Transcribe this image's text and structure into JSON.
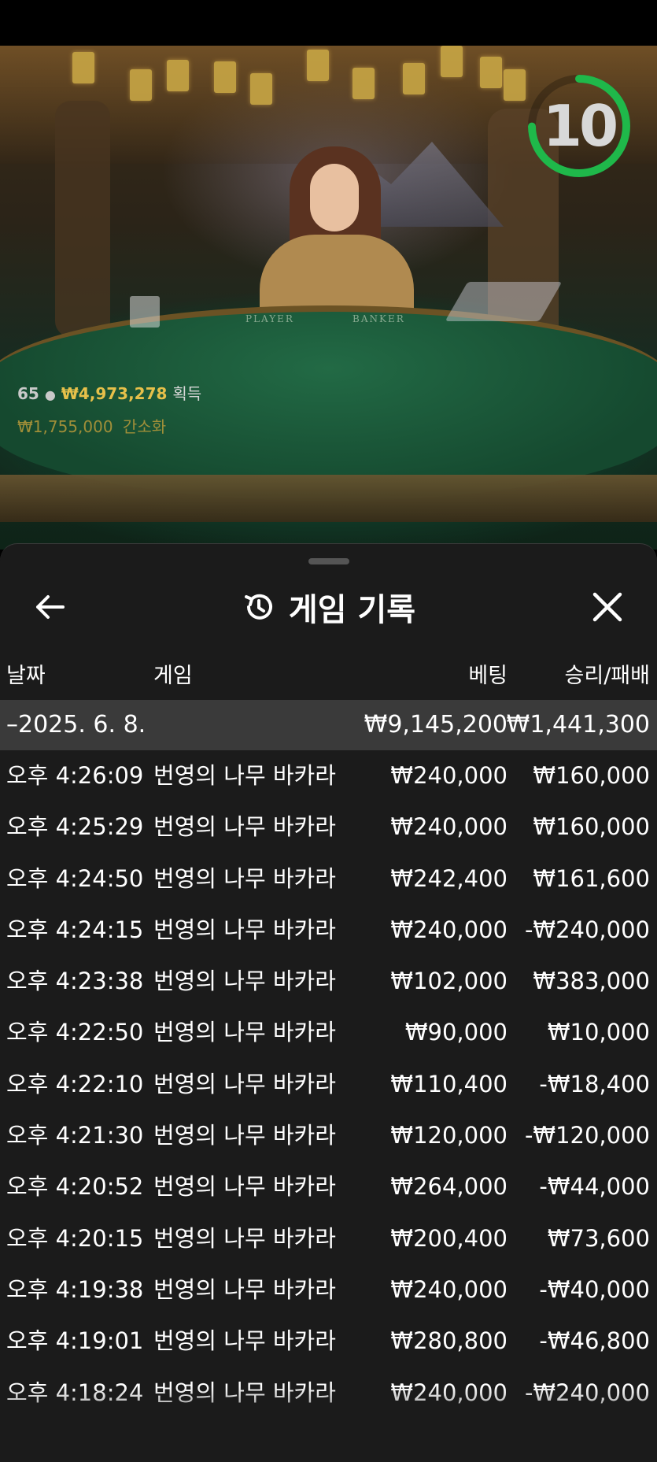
{
  "video": {
    "timer": "10",
    "players": "65",
    "jackpot": "₩4,973,278",
    "jackpot_suffix": "획득",
    "limit": "₩1,755,000",
    "limit_suffix": "간소화",
    "felt_player": "PLAYER",
    "felt_banker": "BANKER",
    "timer_color": "#1fb84a"
  },
  "sheet": {
    "title": "게임 기록",
    "columns": {
      "date": "날짜",
      "game": "게임",
      "bet": "베팅",
      "result": "승리/패배"
    },
    "summary": {
      "date": "–2025. 6. 8.",
      "bet": "₩9,145,200",
      "result": "₩1,441,300"
    },
    "rows": [
      {
        "time": "오후 4:26:09",
        "game": "번영의 나무 바카라",
        "bet": "₩240,000",
        "result": "₩160,000"
      },
      {
        "time": "오후 4:25:29",
        "game": "번영의 나무 바카라",
        "bet": "₩240,000",
        "result": "₩160,000"
      },
      {
        "time": "오후 4:24:50",
        "game": "번영의 나무 바카라",
        "bet": "₩242,400",
        "result": "₩161,600"
      },
      {
        "time": "오후 4:24:15",
        "game": "번영의 나무 바카라",
        "bet": "₩240,000",
        "result": "-₩240,000"
      },
      {
        "time": "오후 4:23:38",
        "game": "번영의 나무 바카라",
        "bet": "₩102,000",
        "result": "₩383,000"
      },
      {
        "time": "오후 4:22:50",
        "game": "번영의 나무 바카라",
        "bet": "₩90,000",
        "result": "₩10,000"
      },
      {
        "time": "오후 4:22:10",
        "game": "번영의 나무 바카라",
        "bet": "₩110,400",
        "result": "-₩18,400"
      },
      {
        "time": "오후 4:21:30",
        "game": "번영의 나무 바카라",
        "bet": "₩120,000",
        "result": "-₩120,000"
      },
      {
        "time": "오후 4:20:52",
        "game": "번영의 나무 바카라",
        "bet": "₩264,000",
        "result": "-₩44,000"
      },
      {
        "time": "오후 4:20:15",
        "game": "번영의 나무 바카라",
        "bet": "₩200,400",
        "result": "₩73,600"
      },
      {
        "time": "오후 4:19:38",
        "game": "번영의 나무 바카라",
        "bet": "₩240,000",
        "result": "-₩40,000"
      },
      {
        "time": "오후 4:19:01",
        "game": "번영의 나무 바카라",
        "bet": "₩280,800",
        "result": "-₩46,800"
      },
      {
        "time": "오후 4:18:24",
        "game": "번영의 나무 바카라",
        "bet": "₩240,000",
        "result": "-₩240,000"
      }
    ],
    "icons": {
      "back": "arrow-left-icon",
      "history": "history-icon",
      "close": "close-icon"
    }
  }
}
